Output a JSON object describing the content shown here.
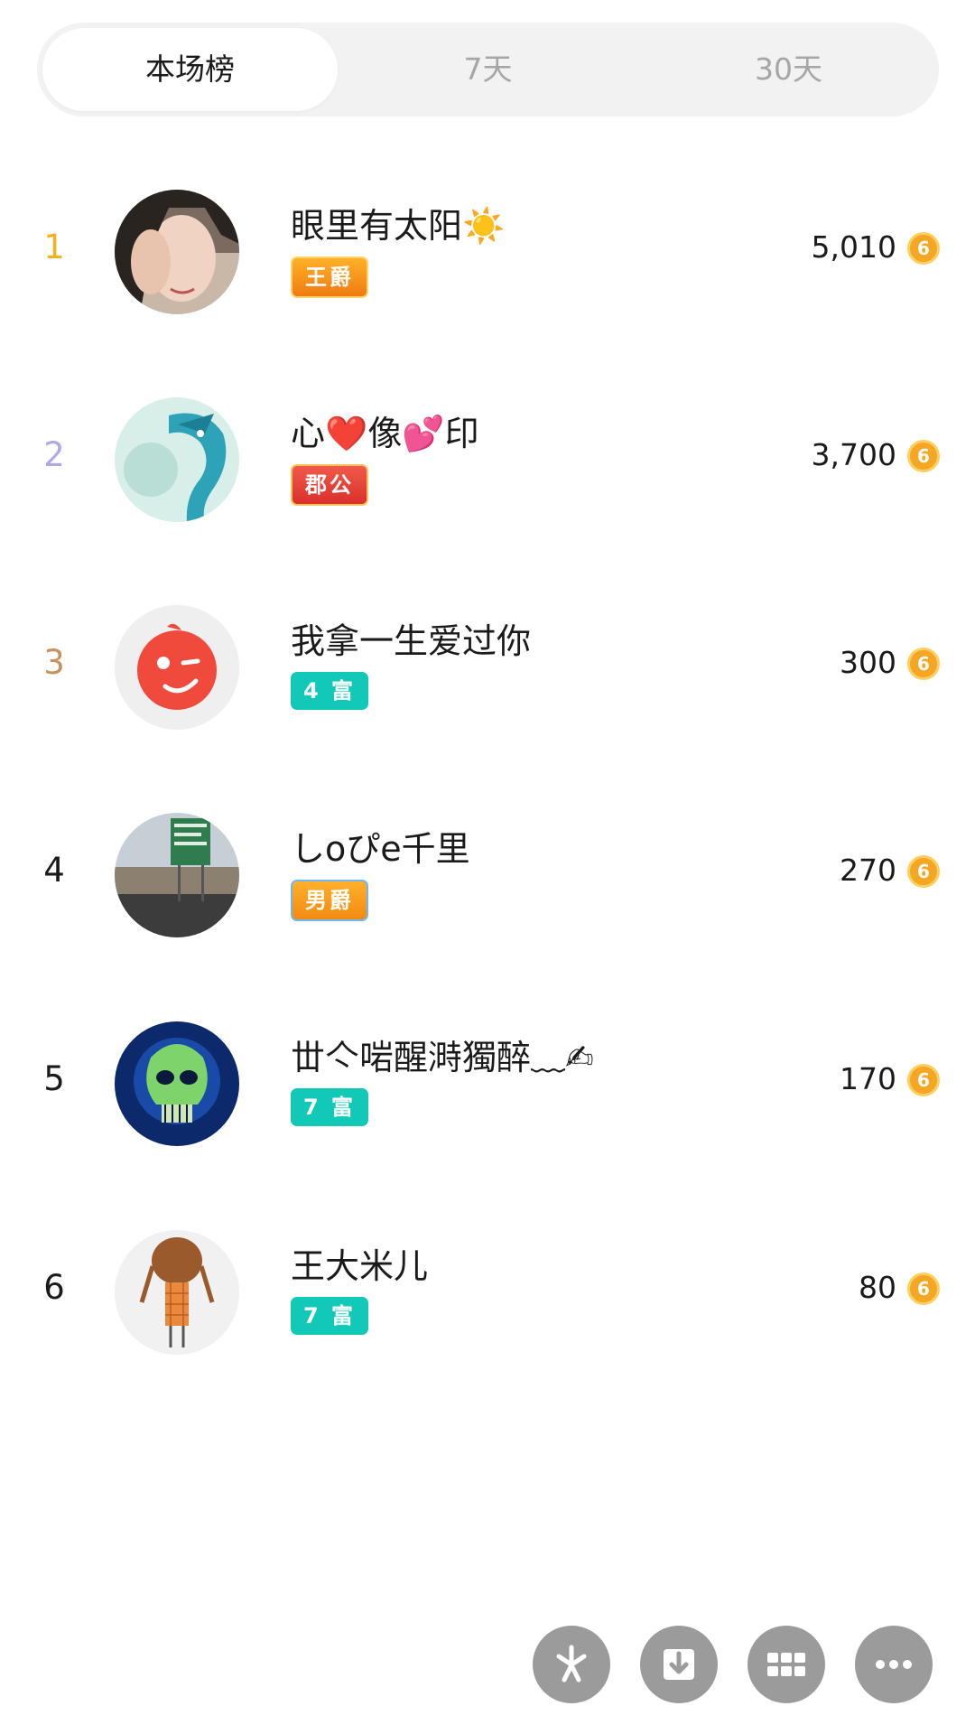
{
  "tabs": [
    {
      "label": "本场榜",
      "active": true
    },
    {
      "label": "7天",
      "active": false
    },
    {
      "label": "30天",
      "active": false
    }
  ],
  "rows": [
    {
      "rank": "1",
      "name": "眼里有太阳☀️",
      "badge": "王爵",
      "badge_style": "gold",
      "amount": "5,010",
      "avatar": "woman-photo"
    },
    {
      "rank": "2",
      "name": "心❤️像💕印",
      "badge": "郡公",
      "badge_style": "red",
      "amount": "3,700",
      "avatar": "dragon-art"
    },
    {
      "rank": "3",
      "name": "我拿一生爱过你",
      "badge": "4 富",
      "badge_style": "teal",
      "amount": "300",
      "avatar": "red-wink-face"
    },
    {
      "rank": "4",
      "name": "しoぴe千里",
      "badge": "男爵",
      "badge_style": "orange",
      "amount": "270",
      "avatar": "road-sign-photo"
    },
    {
      "rank": "5",
      "name": "丗亽啱醒溡獨醉﹏✍",
      "badge": "7 富",
      "badge_style": "teal",
      "amount": "170",
      "avatar": "skull-art"
    },
    {
      "rank": "6",
      "name": "王大米儿",
      "badge": "7 富",
      "badge_style": "teal",
      "amount": "80",
      "avatar": "girl-cartoon"
    }
  ],
  "coin_symbol": "6",
  "bottom_actions": [
    {
      "icon": "sparkle-icon"
    },
    {
      "icon": "download-icon"
    },
    {
      "icon": "grid-icon"
    },
    {
      "icon": "more-icon"
    }
  ],
  "colors": {
    "rank1": "#f2b21b",
    "rank2": "#b3a8e6",
    "rank3": "#c9915e",
    "teal_badge": "#12c9b7",
    "coin": "#f5a623"
  }
}
